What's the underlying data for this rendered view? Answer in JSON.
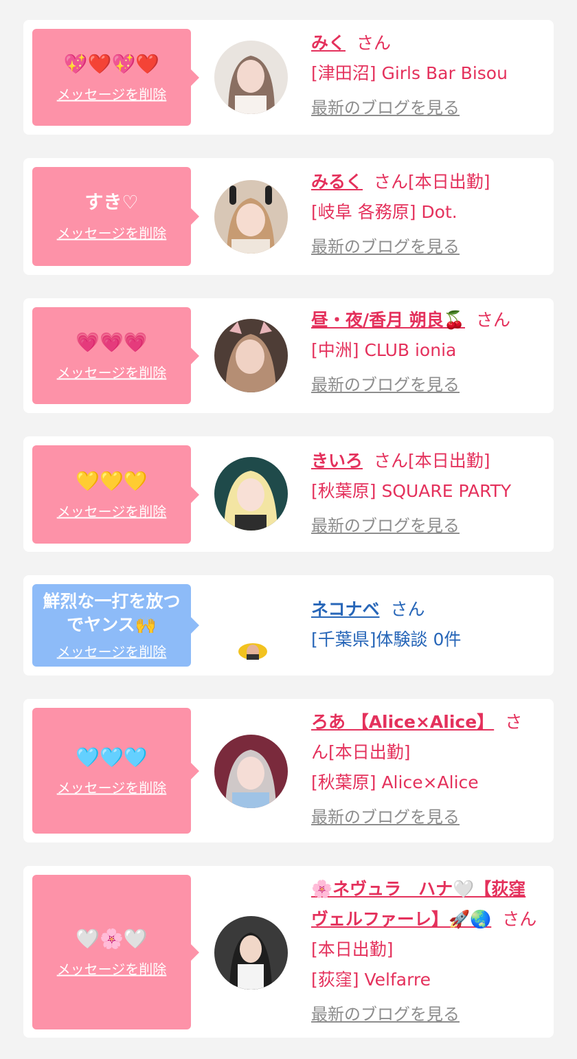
{
  "common": {
    "delete_label": "メッセージを削除",
    "blog_label": "最新のブログを見る",
    "san_label": "さん"
  },
  "cards": [
    {
      "message": "💖❤️💖❤️",
      "name": "みく",
      "status": "",
      "shop": "[津田沼] Girls Bar Bisou"
    },
    {
      "message": "すき♡",
      "name": "みるく",
      "status": "[本日出勤]",
      "shop": "[岐阜 各務原] Dot."
    },
    {
      "message": "💗💗💗",
      "name": "昼・夜/香月 朔良🍒",
      "status": "",
      "shop": "[中洲] CLUB ionia"
    },
    {
      "message": "💛💛💛",
      "name": "きいろ",
      "status": "[本日出勤]",
      "shop": "[秋葉原] SQUARE PARTY"
    },
    {
      "message": "鮮烈な一打を放つでヤンス🙌",
      "name": "ネコナベ",
      "status": "",
      "shop": "[千葉県]体験談 0件"
    },
    {
      "message": "🩵🩵🩵",
      "name": "ろあ 【Alice×Alice】",
      "status": "[本日出勤]",
      "shop": "[秋葉原] Alice×Alice"
    },
    {
      "message": "🤍🌸🤍",
      "name": "🌸ネヴュラ　ハナ🤍【荻窪ヴェルファーレ】🚀🌏",
      "status": "[本日出勤]",
      "shop": "[荻窪] Velfarre"
    }
  ],
  "colors": {
    "pink_bubble": "#fd92a8",
    "blue_bubble": "#8dbbf8",
    "accent_text": "#e4315c",
    "user_text": "#2766b8",
    "blog_link": "#8d8d8d"
  }
}
